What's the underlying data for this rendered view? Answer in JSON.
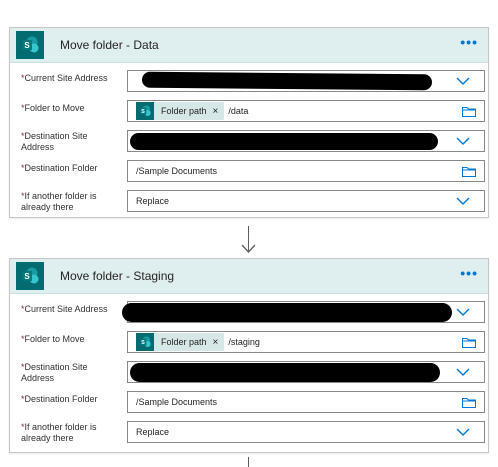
{
  "colors": {
    "accent": "#0078d4",
    "sharepoint": "#036c70",
    "header_bg": "#dfeeef",
    "token_bg": "#d6e7e8"
  },
  "actions": [
    {
      "title": "Move folder - Data",
      "icon": "sharepoint-icon",
      "menu": "•••",
      "fields": {
        "current_site_label": "Current Site Address",
        "folder_to_move_label": "Folder to Move",
        "folder_token": "Folder path",
        "folder_token_close": "×",
        "folder_suffix": "/data",
        "dest_site_label": "Destination Site Address",
        "dest_folder_label": "Destination Folder",
        "dest_folder_value": "/Sample Documents",
        "if_exists_label": "If another folder is already there",
        "if_exists_value": "Replace"
      }
    },
    {
      "title": "Move folder - Staging",
      "icon": "sharepoint-icon",
      "menu": "•••",
      "fields": {
        "current_site_label": "Current Site Address",
        "folder_to_move_label": "Folder to Move",
        "folder_token": "Folder path",
        "folder_token_close": "×",
        "folder_suffix": "/staging",
        "dest_site_label": "Destination Site Address",
        "dest_folder_label": "Destination Folder",
        "dest_folder_value": "/Sample Documents",
        "if_exists_label": "If another folder is already there",
        "if_exists_value": "Replace"
      }
    }
  ],
  "required_marker": "*"
}
